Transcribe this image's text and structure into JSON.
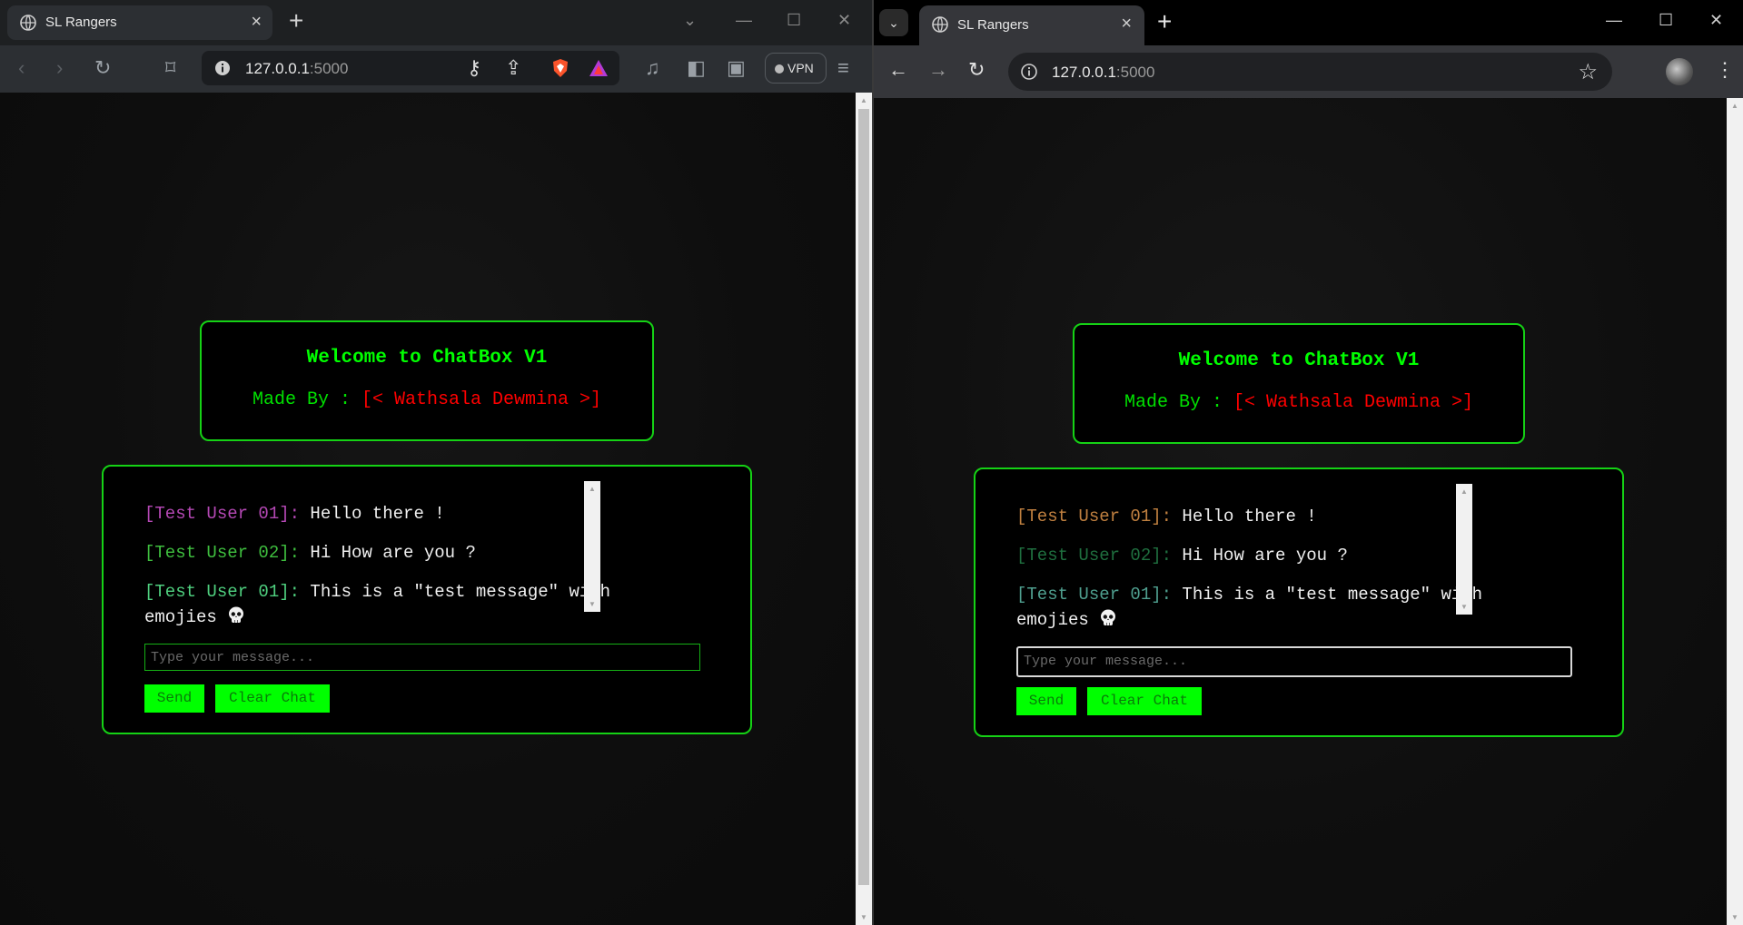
{
  "window_a": {
    "tab_title": "SL Rangers",
    "url_host": "127.0.0.1",
    "url_port": ":5000",
    "vpn_label": "VPN",
    "page": {
      "header": {
        "title": "Welcome to ChatBox V1",
        "made_by": "Made By :",
        "author": "[< Wathsala Dewmina >]"
      },
      "messages": [
        {
          "user": "[Test User 01]:",
          "text": " Hello there !",
          "user_color": "#b548b5"
        },
        {
          "user": "[Test User 02]:",
          "text": " Hi How are you ?",
          "user_color": "#3fbf3f"
        },
        {
          "user": "[Test User 01]:",
          "text": " This is a \"test message\" with",
          "user_color": "#4fd07f"
        },
        {
          "user": "",
          "text": "emojies",
          "user_color": "#4fd07f"
        }
      ],
      "input_placeholder": "Type your message...",
      "send_label": "Send",
      "clear_label": "Clear Chat"
    }
  },
  "window_b": {
    "tab_title": "SL Rangers",
    "url_host": "127.0.0.1",
    "url_port": ":5000",
    "page": {
      "header": {
        "title": "Welcome to ChatBox V1",
        "made_by": "Made By :",
        "author": "[< Wathsala Dewmina >]"
      },
      "messages": [
        {
          "user": "[Test User 01]:",
          "text": " Hello there !",
          "user_color": "#c08040"
        },
        {
          "user": "[Test User 02]:",
          "text": " Hi How are you ?",
          "user_color": "#1f6f3f"
        },
        {
          "user": "[Test User 01]:",
          "text": " This is a \"test message\" with",
          "user_color": "#4f9f8f"
        },
        {
          "user": "",
          "text": "emojies",
          "user_color": "#4f9f8f"
        }
      ],
      "input_placeholder": "Type your message...",
      "send_label": "Send",
      "clear_label": "Clear Chat"
    }
  },
  "colors": {
    "accent_green": "#00ff00",
    "border_green": "#15d215",
    "author_red": "#ff0000"
  }
}
